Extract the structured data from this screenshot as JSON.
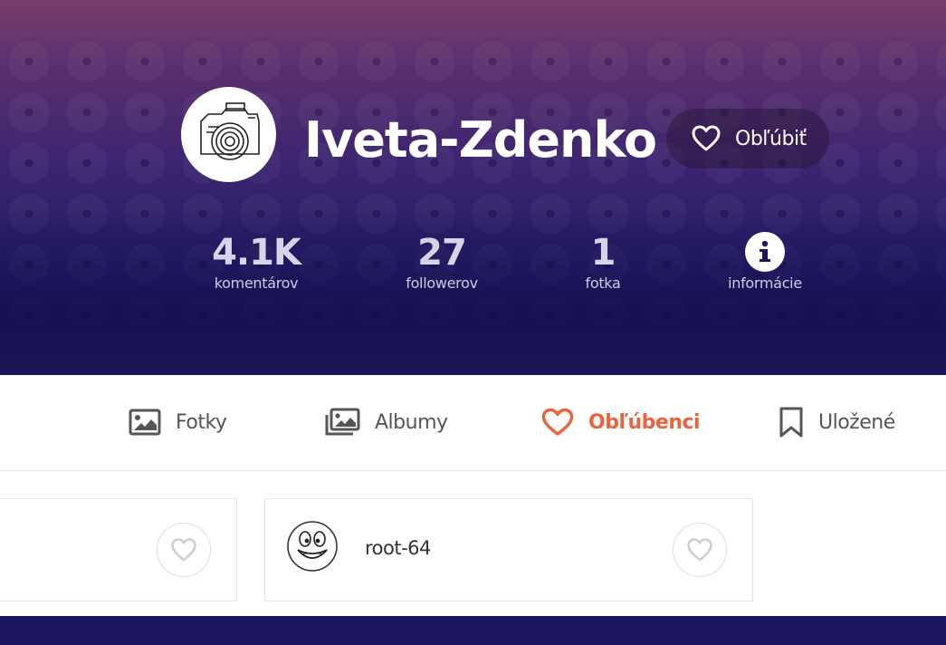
{
  "profile": {
    "name": "Iveta-Zdenko",
    "favorite_button_label": "Obľúbiť"
  },
  "stats": [
    {
      "value": "4.1K",
      "label": "komentárov"
    },
    {
      "value": "27",
      "label": "followerov"
    },
    {
      "value": "1",
      "label": "fotka"
    },
    {
      "icon": "info-icon",
      "label": "informácie"
    }
  ],
  "tabs": [
    {
      "label": "Fotky",
      "icon": "image-icon",
      "active": false
    },
    {
      "label": "Albumy",
      "icon": "albums-icon",
      "active": false
    },
    {
      "label": "Obľúbenci",
      "icon": "heart-icon",
      "active": true
    },
    {
      "label": "Uložené",
      "icon": "bookmark-icon",
      "active": false
    }
  ],
  "favorites": [
    {
      "name": "",
      "avatar_icon": "user-avatar"
    },
    {
      "name": "root-64",
      "avatar_icon": "smiley-face-icon"
    }
  ],
  "colors": {
    "accent": "#e8643c",
    "header_dark": "#1c1658",
    "tab_text": "#555555"
  }
}
